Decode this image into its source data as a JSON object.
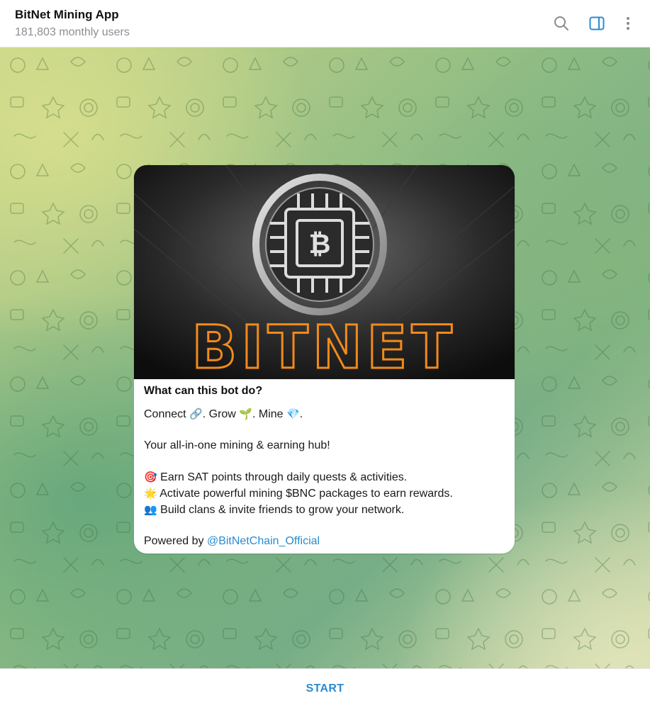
{
  "header": {
    "title": "BitNet Mining App",
    "subtitle": "181,803 monthly users",
    "icons": [
      "search-icon",
      "sidebar-toggle-icon",
      "more-vertical-icon"
    ],
    "accent_color": "#2a8bd0"
  },
  "card": {
    "banner_text": "BITNET",
    "heading": "What can this bot do?",
    "connect": {
      "w1": "Connect",
      "e1": "🔗",
      "w2": ". Grow",
      "e2": "🌱",
      "w3": ". Mine",
      "e3": "💎",
      "end": "."
    },
    "hub": "Your all-in-one mining & earning hub!",
    "items": [
      {
        "emoji": "🎯",
        "text": "Earn SAT points through daily quests & activities."
      },
      {
        "emoji": "🌟",
        "text": "Activate powerful mining $BNC packages to earn rewards."
      },
      {
        "emoji": "👥",
        "text": "Build clans & invite friends to grow your network."
      }
    ],
    "powered_by": "Powered by",
    "link": "@BitNetChain_Official"
  },
  "footer": {
    "start_label": "START"
  }
}
